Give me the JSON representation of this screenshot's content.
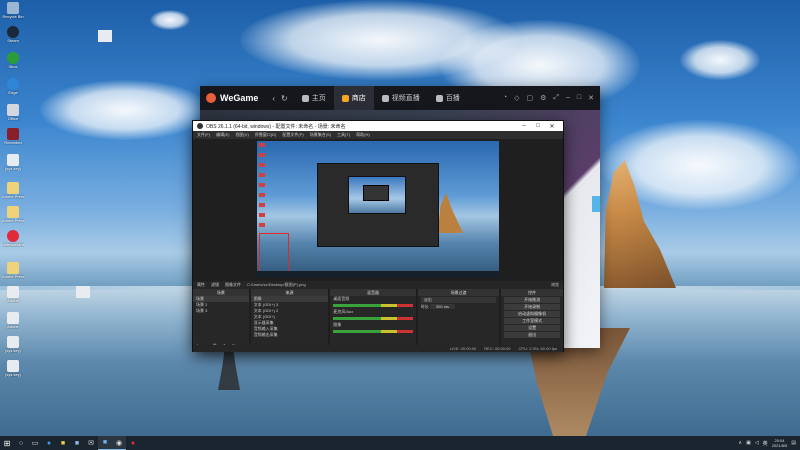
{
  "desktop": {
    "icons": [
      {
        "label": "Recycle Bin"
      },
      {
        "label": "Steam"
      },
      {
        "label": "Xbox"
      },
      {
        "label": "Edge"
      },
      {
        "label": "Office"
      },
      {
        "label": "Recorded"
      },
      {
        "label": "(sys key)"
      },
      {
        "label": "Adobe Premiere"
      },
      {
        "label": "Adobe Premiere"
      },
      {
        "label": "NeteaseMusic"
      },
      {
        "label": "Adobe Premiere"
      },
      {
        "label": "Adobe"
      },
      {
        "label": "Adobe"
      },
      {
        "label": "(sys key)"
      },
      {
        "label": "(sys key)"
      }
    ]
  },
  "wegame": {
    "title": "WeGame",
    "tabs": [
      {
        "label": "主页"
      },
      {
        "label": "商店"
      },
      {
        "label": "视频直播"
      },
      {
        "label": "百播"
      }
    ]
  },
  "obs": {
    "title": "OBS 26.1.1 (64-bit, windows) - 配置文件: 未命名 - 场景: 未命名",
    "menu": [
      "文件(F)",
      "编辑(E)",
      "视图(V)",
      "停靠窗口(D)",
      "配置文件(P)",
      "场景集合(S)",
      "工具(T)",
      "帮助(H)"
    ],
    "ctrlbar": {
      "properties": "属性",
      "filters": "滤镜",
      "image_file": "图像文件",
      "path": "C:/Users/zz/Desktop/截图(P).png",
      "browse": "浏览"
    },
    "scenes": {
      "header": "场景",
      "items": [
        "场景",
        "场景 2",
        "场景 3"
      ]
    },
    "sources": {
      "header": "来源",
      "items": [
        "图像",
        "文本 (GDI+) 3",
        "文本 (GDI+) 2",
        "文本 (GDI+)",
        "显示器采集",
        "音频输入采集",
        "音频输出采集"
      ]
    },
    "mixer": {
      "header": "混音器",
      "channels": [
        "桌面音频",
        "麦克风/Aux",
        "图像"
      ]
    },
    "transitions": {
      "header": "场景过渡",
      "type": "淡出",
      "duration_label": "时长",
      "duration": "300 ms"
    },
    "controls": {
      "header": "控件",
      "buttons": [
        "开始推流",
        "开始录制",
        "启动虚拟摄像机",
        "工作室模式",
        "设置",
        "退出"
      ]
    },
    "status": [
      "LIVE: 00:00:00",
      "REC: 00:00:00",
      "CPU: 2.3%, 60.00 fps"
    ]
  },
  "taskbar": {
    "time": "20:04",
    "date": "2021/8/5",
    "lang": "英"
  }
}
